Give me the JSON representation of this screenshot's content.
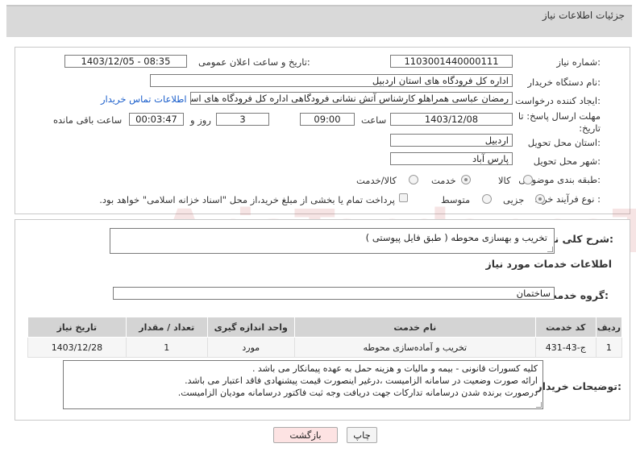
{
  "header": {
    "title": "جزئیات اطلاعات نیاز"
  },
  "fields": {
    "need_number": {
      "label": "شماره نیاز:",
      "value": "1103001440000111"
    },
    "announce_date": {
      "label": "تاریخ و ساعت اعلان عمومی:",
      "value": "1403/12/05 - 08:35"
    },
    "buyer_org": {
      "label": "نام دستگاه خریدار:",
      "value": "اداره کل فرودگاه های استان اردبیل"
    },
    "requester": {
      "label": "ایجاد کننده درخواست:",
      "value": "رمضان عباسی همراهلو  کارشناس آتش نشانی فرودگاهی اداره کل فرودگاه های استان اردبیل"
    },
    "contact_link": "اطلاعات تماس خریدار",
    "deadline": {
      "label": "مهلت ارسال پاسخ: تا تاریخ:",
      "date": "1403/12/08",
      "time_label": "ساعت",
      "time": "09:00",
      "days": "3",
      "days_label": "روز و",
      "remaining": "00:03:47",
      "remaining_label": "ساعت باقی مانده"
    },
    "province": {
      "label": "استان محل تحویل:",
      "value": "اردبیل"
    },
    "city": {
      "label": "شهر محل تحویل:",
      "value": "پارس آباد"
    },
    "category": {
      "label": "طبقه بندی موضوعی:",
      "options": [
        "کالا",
        "خدمت",
        "کالا/خدمت"
      ],
      "selected": "خدمت"
    },
    "process_type": {
      "label": "نوع فرآیند خرید :",
      "options": [
        "جزیی",
        "متوسط"
      ],
      "selected": "جزیی",
      "checkbox_label": "پرداخت تمام یا بخشی از مبلغ خرید،از محل \"اسناد خزانه اسلامی\" خواهد بود."
    }
  },
  "description": {
    "label": "شرح کلی نیاز:",
    "value": "تخریب و بهسازی محوطه ( طبق فایل پیوستی )"
  },
  "services": {
    "section_title": "اطلاعات خدمات مورد نیاز",
    "group_label": "گروه خدمت:",
    "group_value": "ساختمان",
    "columns": [
      "ردیف",
      "کد خدمت",
      "نام خدمت",
      "واحد اندازه گیری",
      "تعداد / مقدار",
      "تاریخ نیاز"
    ],
    "rows": [
      [
        "1",
        "ج-43-431",
        "تخریب و آماده‌سازی محوطه",
        "مورد",
        "1",
        "1403/12/28"
      ]
    ]
  },
  "buyer_notes": {
    "label": "توضیحات خریدار:",
    "lines": [
      "کلیه کسورات قانونی - بیمه و مالیات و هزینه حمل به عهده پیمانکار می باشد .",
      "ارائه صورت وضعیت در سامانه الزامیست ،درغیر اینصورت قیمت پیشنهادی فاقد اعتبار می باشد.",
      "درصورت برنده شدن درسامانه تدارکات جهت دریافت وجه ثبت فاکتور درسامانه مودیان الزامیست."
    ]
  },
  "buttons": {
    "back": "بازگشت",
    "print": "چاپ"
  },
  "watermark": "AriaTender.neT",
  "colors": {
    "link": "#1a5ecb",
    "header_bg": "#d9d9d9",
    "back_button": "#fde3e3"
  }
}
